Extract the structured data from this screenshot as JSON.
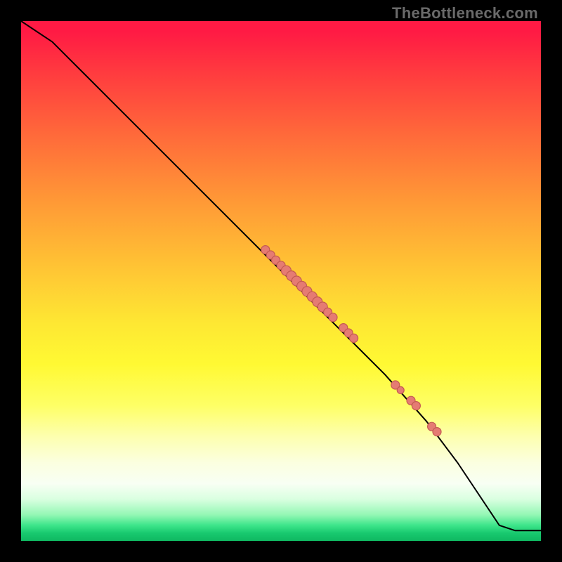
{
  "watermark": "TheBottleneck.com",
  "colors": {
    "dot_fill": "#e57b73",
    "dot_stroke": "#c35a52",
    "curve": "#000000"
  },
  "chart_data": {
    "type": "line",
    "title": "",
    "xlabel": "",
    "ylabel": "",
    "xlim": [
      0,
      100
    ],
    "ylim": [
      0,
      100
    ],
    "grid": false,
    "legend": false,
    "series": [
      {
        "name": "curve",
        "x": [
          0,
          3,
          6,
          9,
          12,
          18,
          30,
          40,
          50,
          60,
          70,
          78,
          84,
          90,
          92,
          95,
          100
        ],
        "y": [
          100,
          98,
          96,
          93,
          90,
          84,
          72,
          62,
          52,
          42,
          32,
          23,
          15,
          6,
          3,
          2,
          2
        ]
      }
    ],
    "points": [
      {
        "name": "cluster-top",
        "x": 47,
        "y": 56,
        "r": 6
      },
      {
        "name": "cluster-top",
        "x": 48,
        "y": 55,
        "r": 6
      },
      {
        "name": "cluster-top",
        "x": 49,
        "y": 54,
        "r": 6
      },
      {
        "name": "cluster-top",
        "x": 50,
        "y": 53,
        "r": 6
      },
      {
        "name": "cluster-mid",
        "x": 51,
        "y": 52,
        "r": 7
      },
      {
        "name": "cluster-mid",
        "x": 52,
        "y": 51,
        "r": 7
      },
      {
        "name": "cluster-mid",
        "x": 53,
        "y": 50,
        "r": 7
      },
      {
        "name": "cluster-mid",
        "x": 54,
        "y": 49,
        "r": 7
      },
      {
        "name": "cluster-mid",
        "x": 55,
        "y": 48,
        "r": 7
      },
      {
        "name": "cluster-mid",
        "x": 56,
        "y": 47,
        "r": 7
      },
      {
        "name": "cluster-mid",
        "x": 57,
        "y": 46,
        "r": 7
      },
      {
        "name": "cluster-mid",
        "x": 58,
        "y": 45,
        "r": 7
      },
      {
        "name": "cluster-mid",
        "x": 59,
        "y": 44,
        "r": 6
      },
      {
        "name": "cluster-mid",
        "x": 60,
        "y": 43,
        "r": 6
      },
      {
        "name": "cluster-low",
        "x": 62,
        "y": 41,
        "r": 6
      },
      {
        "name": "cluster-low",
        "x": 63,
        "y": 40,
        "r": 6
      },
      {
        "name": "cluster-low",
        "x": 64,
        "y": 39,
        "r": 6
      },
      {
        "name": "tail",
        "x": 72,
        "y": 30,
        "r": 6
      },
      {
        "name": "tail",
        "x": 73,
        "y": 29,
        "r": 5
      },
      {
        "name": "tail",
        "x": 75,
        "y": 27,
        "r": 6
      },
      {
        "name": "tail",
        "x": 76,
        "y": 26,
        "r": 6
      },
      {
        "name": "tail",
        "x": 79,
        "y": 22,
        "r": 6
      },
      {
        "name": "tail",
        "x": 80,
        "y": 21,
        "r": 6
      }
    ]
  }
}
